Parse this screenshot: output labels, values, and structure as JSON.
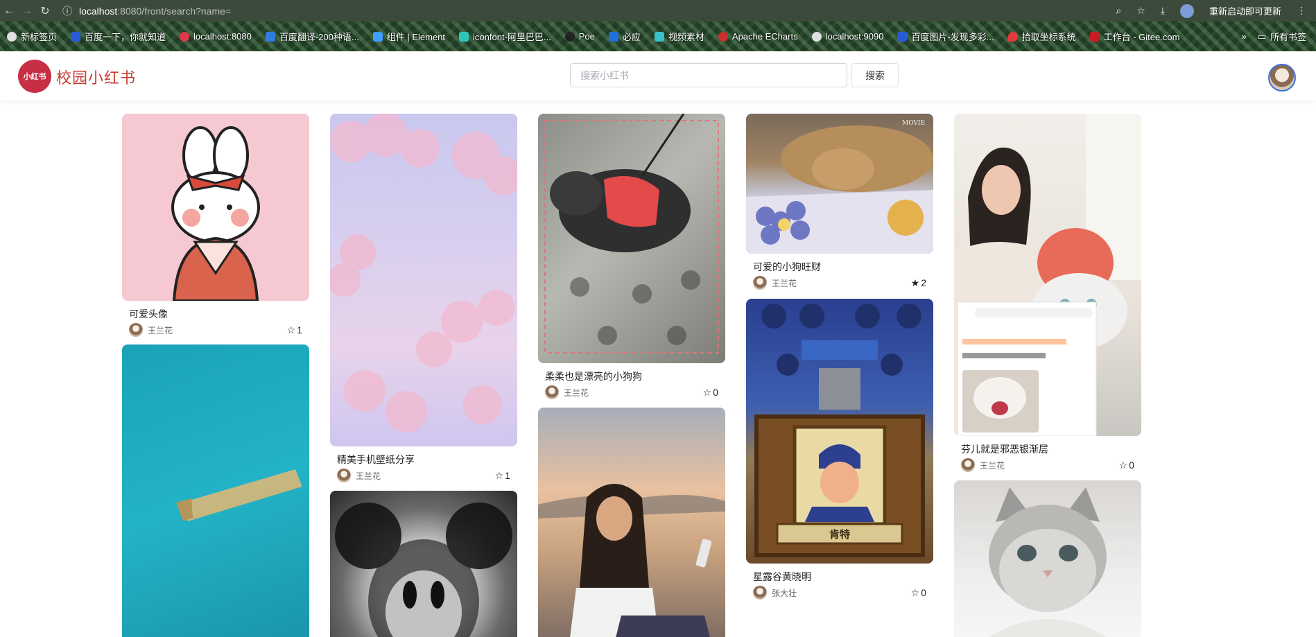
{
  "browser": {
    "url_host": "localhost",
    "url_path": ":8080/front/search?name=",
    "restart_label": "重新启动即可更新",
    "bookmarks": [
      "新标签页",
      "百度一下，你就知道",
      "localhost:8080",
      "百度翻译-200种语...",
      "组件 | Element",
      "iconfont-阿里巴巴...",
      "Poe",
      "必应",
      "视频素材",
      "Apache ECharts",
      "localhost:9090",
      "百度图片-发现多彩...",
      "拾取坐标系统",
      "工作台 - Gitee.com"
    ],
    "bookmarks_more": "»",
    "all_bookmarks": "所有书签"
  },
  "header": {
    "logo_badge": "小红书",
    "app_name": "校园小红书",
    "search_placeholder": "搜索小红书",
    "search_button": "搜索"
  },
  "posts": [
    {
      "title": "可爱头像",
      "author": "王兰花",
      "likes": "1",
      "star": "☆"
    },
    {
      "title": "",
      "author": "",
      "likes": "",
      "star": ""
    },
    {
      "title": "精美手机壁纸分享",
      "author": "王兰花",
      "likes": "1",
      "star": "☆"
    },
    {
      "title": "",
      "author": "",
      "likes": "",
      "star": ""
    },
    {
      "title": "柔柔也是漂亮的小狗狗",
      "author": "王兰花",
      "likes": "0",
      "star": "☆"
    },
    {
      "title": "",
      "author": "",
      "likes": "",
      "star": ""
    },
    {
      "title": "可爱的小狗旺财",
      "author": "王兰花",
      "likes": "2",
      "star": "★"
    },
    {
      "title": "星露谷黄晓明",
      "author": "张大壮",
      "likes": "0",
      "star": "☆"
    },
    {
      "title": "芬儿就是邪恶银渐层",
      "author": "王兰花",
      "likes": "0",
      "star": "☆"
    },
    {
      "title": "",
      "author": "",
      "likes": "",
      "star": ""
    }
  ],
  "image_labels": {
    "stardew_name": "肯特",
    "movie_tag": "MOVIE"
  }
}
